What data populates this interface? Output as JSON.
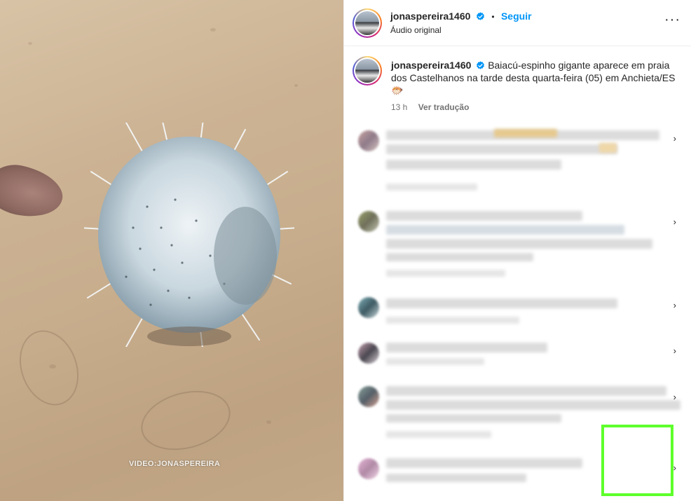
{
  "media": {
    "watermark": "VIDEO:JONASPEREIRA"
  },
  "header": {
    "username": "jonaspereira1460",
    "separator": "•",
    "follow_label": "Seguir",
    "audio_label": "Áudio original",
    "more_label": "···"
  },
  "caption": {
    "username": "jonaspereira1460",
    "text": "Baiacú-espinho gigante aparece em praia dos Castelhanos na tarde desta quarta-feira (05) em Anchieta/ES",
    "emoji": "🐡",
    "time": "13 h",
    "translate_label": "Ver tradução"
  },
  "comments": {
    "chevron": "›"
  },
  "colors": {
    "accent": "#0095f6",
    "verified": "#0095f6",
    "highlight": "#5eff2b",
    "text": "#262626",
    "muted": "#737373"
  }
}
